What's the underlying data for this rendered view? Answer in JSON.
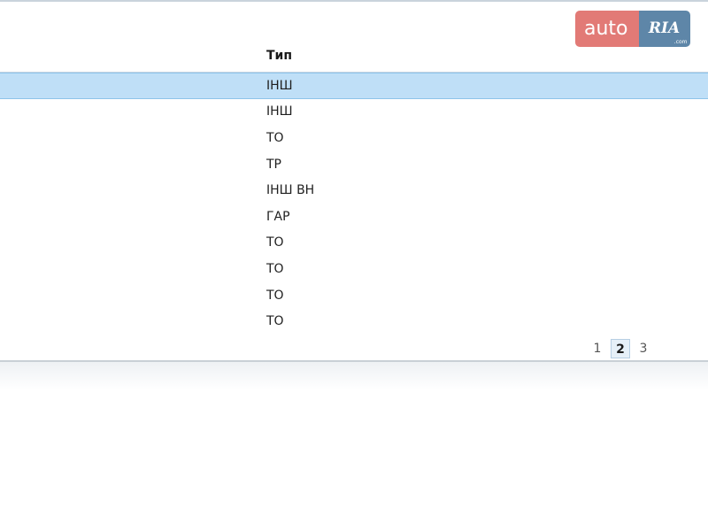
{
  "table": {
    "column_header": "Тип",
    "rows": [
      {
        "type": "ІНШ",
        "selected": true
      },
      {
        "type": "ІНШ",
        "selected": false
      },
      {
        "type": "ТО",
        "selected": false
      },
      {
        "type": "ТР",
        "selected": false
      },
      {
        "type": "ІНШ ВН",
        "selected": false
      },
      {
        "type": "ГАР",
        "selected": false
      },
      {
        "type": "ТО",
        "selected": false
      },
      {
        "type": "ТО",
        "selected": false
      },
      {
        "type": "ТО",
        "selected": false
      },
      {
        "type": "ТО",
        "selected": false
      }
    ]
  },
  "pagination": {
    "pages": [
      "1",
      "2",
      "3"
    ],
    "current": "2"
  },
  "watermark": {
    "left_text": "auto",
    "right_text": "RIA",
    "suffix": ".com",
    "left_color": "#df6c68",
    "right_color": "#4d7a9f"
  },
  "colors": {
    "selected_row": "#bfdff7",
    "selected_row_border": "#8ec4ea"
  }
}
